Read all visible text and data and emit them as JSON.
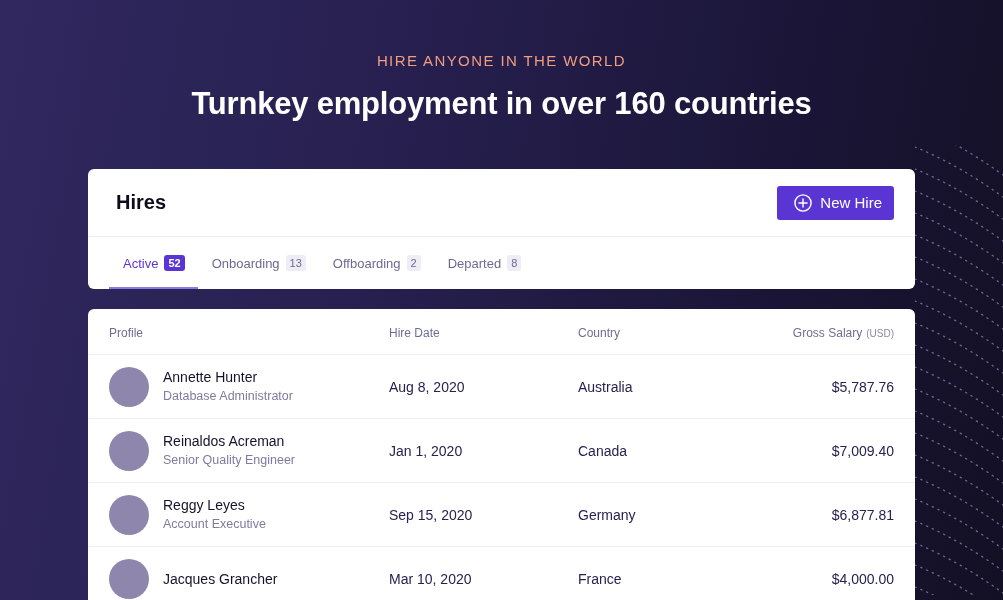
{
  "hero": {
    "eyebrow": "HIRE ANYONE IN THE WORLD",
    "title": "Turnkey employment in over 160 countries"
  },
  "hires_card": {
    "title": "Hires",
    "new_button": {
      "label": "New Hire"
    },
    "tabs": [
      {
        "label": "Active",
        "count": "52",
        "selected": true
      },
      {
        "label": "Onboarding",
        "count": "13",
        "selected": false
      },
      {
        "label": "Offboarding",
        "count": "2",
        "selected": false
      },
      {
        "label": "Departed",
        "count": "8",
        "selected": false
      }
    ]
  },
  "table": {
    "columns": [
      {
        "label": "Profile"
      },
      {
        "label": "Hire Date"
      },
      {
        "label": "Country"
      },
      {
        "label": "Gross Salary",
        "unit": "(USD)"
      }
    ],
    "rows": [
      {
        "name": "Annette Hunter",
        "role": "Database Administrator",
        "hire_date": "Aug 8, 2020",
        "country": "Australia",
        "salary": "$5,787.76"
      },
      {
        "name": "Reinaldos Acreman",
        "role": "Senior Quality Engineer",
        "hire_date": "Jan 1, 2020",
        "country": "Canada",
        "salary": "$7,009.40"
      },
      {
        "name": "Reggy Leyes",
        "role": "Account Executive",
        "hire_date": "Sep 15, 2020",
        "country": "Germany",
        "salary": "$6,877.81"
      },
      {
        "name": "Jacques Grancher",
        "hire_date": "Mar 10, 2020",
        "country": "France",
        "salary": "$4,000.00"
      }
    ]
  }
}
